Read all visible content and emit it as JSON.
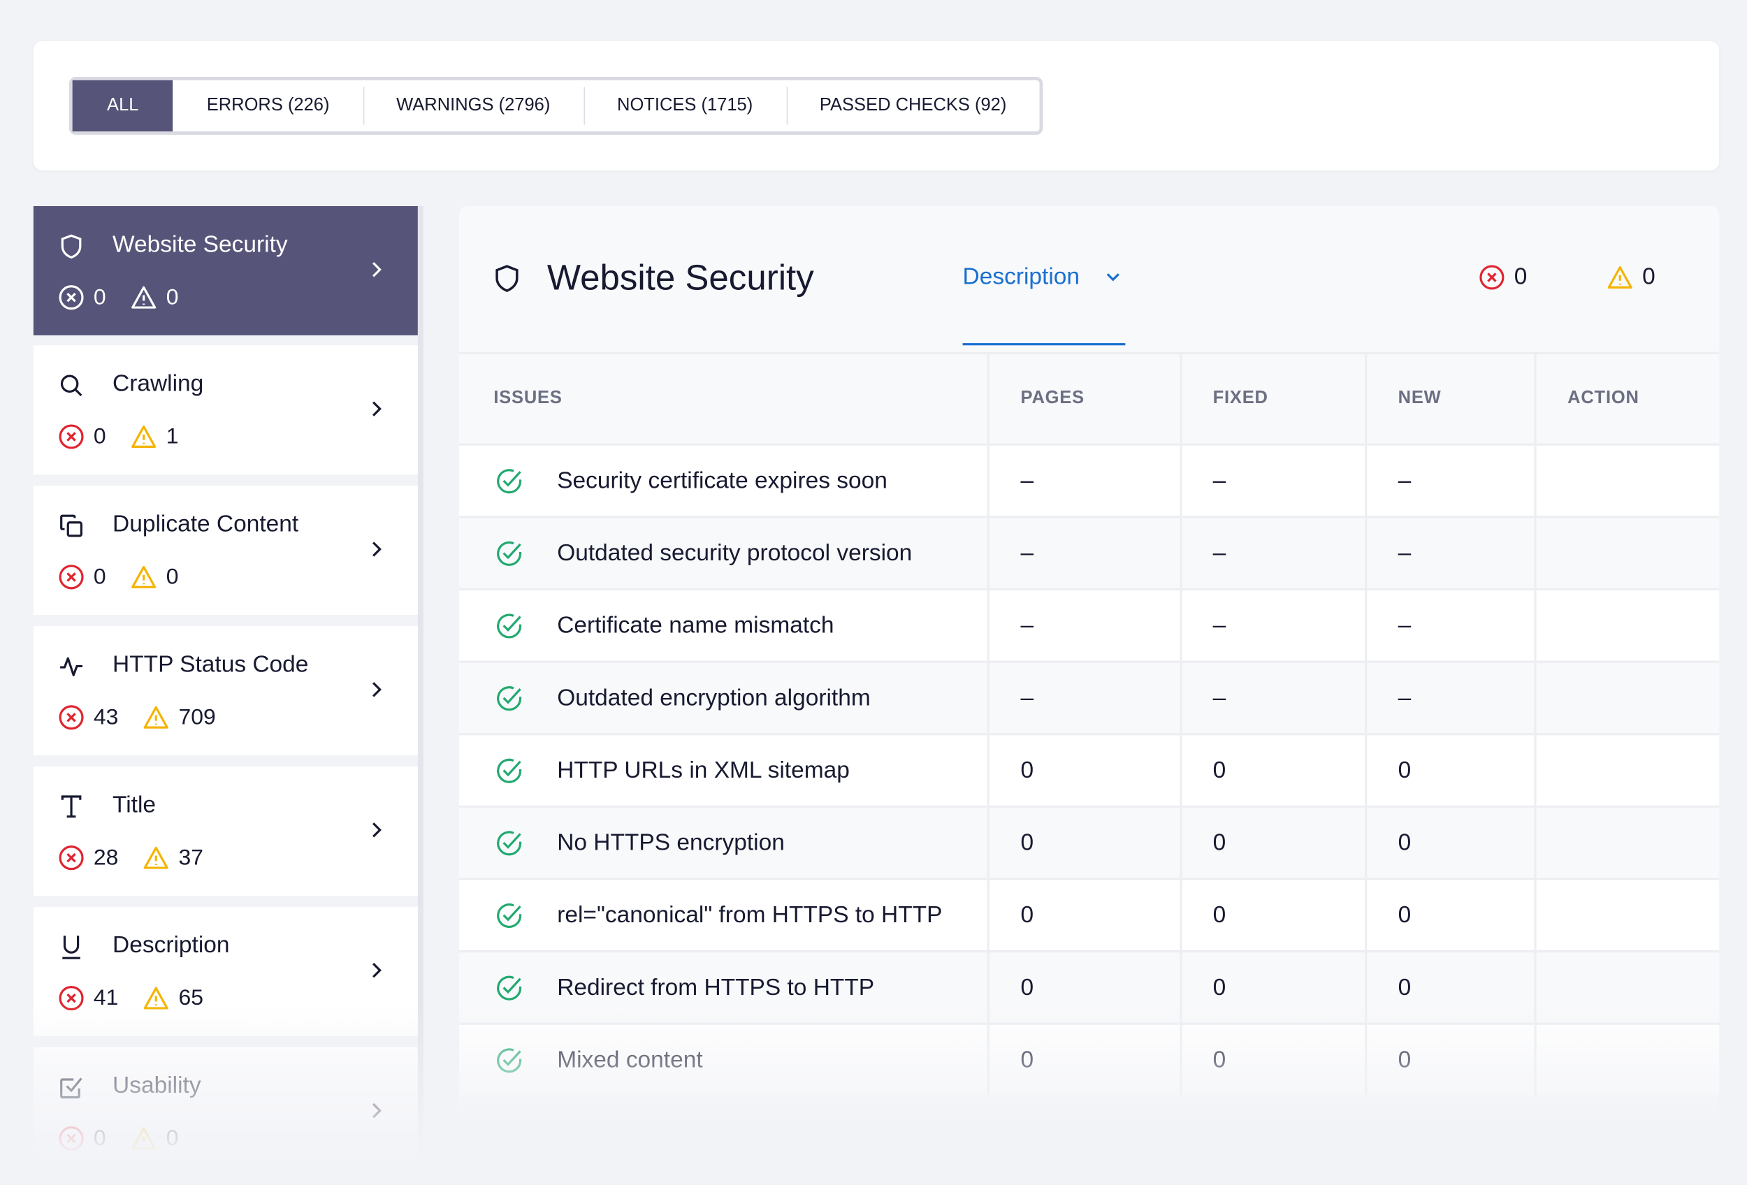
{
  "filter_tabs": [
    {
      "label": "ALL",
      "active": true
    },
    {
      "label": "ERRORS (226)"
    },
    {
      "label": "WARNINGS (2796)"
    },
    {
      "label": "NOTICES (1715)"
    },
    {
      "label": "PASSED CHECKS (92)"
    }
  ],
  "sidebar": {
    "items": [
      {
        "title": "Website Security",
        "icon": "shield-icon",
        "errors": "0",
        "warnings": "0",
        "active": true
      },
      {
        "title": "Crawling",
        "icon": "search-icon",
        "errors": "0",
        "warnings": "1"
      },
      {
        "title": "Duplicate Content",
        "icon": "copy-icon",
        "errors": "0",
        "warnings": "0"
      },
      {
        "title": "HTTP Status Code",
        "icon": "pulse-icon",
        "errors": "43",
        "warnings": "709"
      },
      {
        "title": "Title",
        "icon": "text-icon",
        "errors": "28",
        "warnings": "37"
      },
      {
        "title": "Description",
        "icon": "underline-icon",
        "errors": "41",
        "warnings": "65"
      },
      {
        "title": "Usability",
        "icon": "checkbox-icon",
        "errors": "0",
        "warnings": "0"
      }
    ]
  },
  "main": {
    "title": "Website Security",
    "description_tab": "Description",
    "errors": "0",
    "warnings": "0",
    "columns": [
      "ISSUES",
      "PAGES",
      "FIXED",
      "NEW",
      "ACTION"
    ],
    "rows": [
      {
        "issue": "Security certificate expires soon",
        "pages": "–",
        "fixed": "–",
        "new": "–"
      },
      {
        "issue": "Outdated security protocol version",
        "pages": "–",
        "fixed": "–",
        "new": "–"
      },
      {
        "issue": "Certificate name mismatch",
        "pages": "–",
        "fixed": "–",
        "new": "–"
      },
      {
        "issue": "Outdated encryption algorithm",
        "pages": "–",
        "fixed": "–",
        "new": "–"
      },
      {
        "issue": "HTTP URLs in XML sitemap",
        "pages": "0",
        "fixed": "0",
        "new": "0"
      },
      {
        "issue": "No HTTPS encryption",
        "pages": "0",
        "fixed": "0",
        "new": "0"
      },
      {
        "issue": "rel=\"canonical\" from HTTPS to HTTP",
        "pages": "0",
        "fixed": "0",
        "new": "0"
      },
      {
        "issue": "Redirect from HTTPS to HTTP",
        "pages": "0",
        "fixed": "0",
        "new": "0"
      },
      {
        "issue": "Mixed content",
        "pages": "0",
        "fixed": "0",
        "new": "0"
      }
    ]
  },
  "colors": {
    "accent": "#565478",
    "link": "#1a6fd0",
    "error": "#e0242f",
    "warning": "#f4b400",
    "passed": "#22a96f"
  }
}
